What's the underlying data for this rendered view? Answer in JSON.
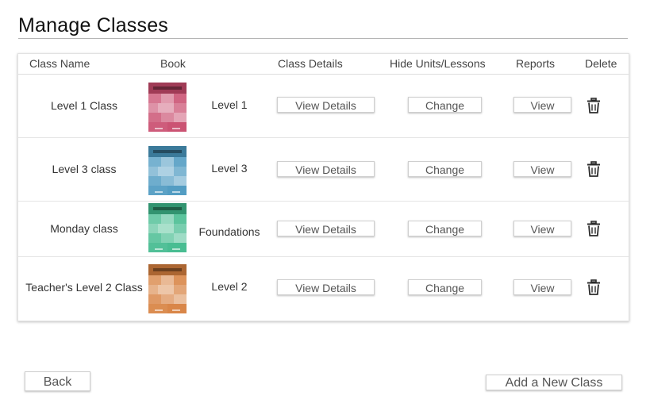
{
  "page": {
    "title": "Manage Classes"
  },
  "table": {
    "headers": {
      "class_name": "Class Name",
      "book": "Book",
      "class_details": "Class Details",
      "hide_units": "Hide Units/Lessons",
      "reports": "Reports",
      "delete": "Delete"
    },
    "rows": [
      {
        "class_name": "Level 1 Class",
        "book_name": "Level 1",
        "book_color": "#c84a6c",
        "details_label": "View Details",
        "change_label": "Change",
        "report_label": "View",
        "delete_icon": "trash-icon"
      },
      {
        "class_name": "Level 3 class",
        "book_name": "Level 3",
        "book_color": "#4a98c0",
        "details_label": "View Details",
        "change_label": "Change",
        "report_label": "View",
        "delete_icon": "trash-icon"
      },
      {
        "class_name": "Monday class",
        "book_name": "Foundations",
        "book_color": "#3fb98c",
        "details_label": "View Details",
        "change_label": "Change",
        "report_label": "View",
        "delete_icon": "trash-icon"
      },
      {
        "class_name": "Teacher's Level 2 Class",
        "book_name": "Level 2",
        "book_color": "#d7803e",
        "details_label": "View Details",
        "change_label": "Change",
        "report_label": "View",
        "delete_icon": "trash-icon"
      }
    ]
  },
  "footer": {
    "back_label": "Back",
    "add_label": "Add a New Class"
  }
}
